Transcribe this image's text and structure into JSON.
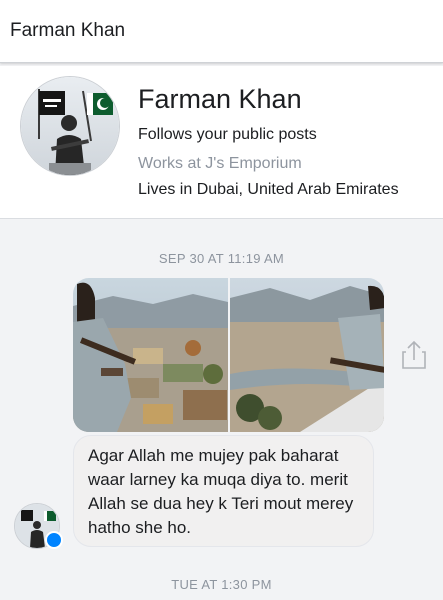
{
  "header": {
    "title": "Farman Khan"
  },
  "profile": {
    "name": "Farman Khan",
    "follows": "Follows your public posts",
    "work": "Works at J's Emporium",
    "lives": "Lives in Dubai, United Arab Emirates"
  },
  "timestamps": [
    "SEP 30 AT 11:19 AM",
    "TUE AT 1:30 PM"
  ],
  "message": {
    "text": "Agar Allah me mujey pak baharat waar larney ka muqa diya to. merit Allah se dua hey k Teri mout merey hatho she ho."
  },
  "colors": {
    "accent": "#0084ff",
    "bubble": "#f1f0f0",
    "timestamp": "#8d949e"
  },
  "icons": {
    "share": "share-icon",
    "messenger": "messenger-badge-icon"
  }
}
